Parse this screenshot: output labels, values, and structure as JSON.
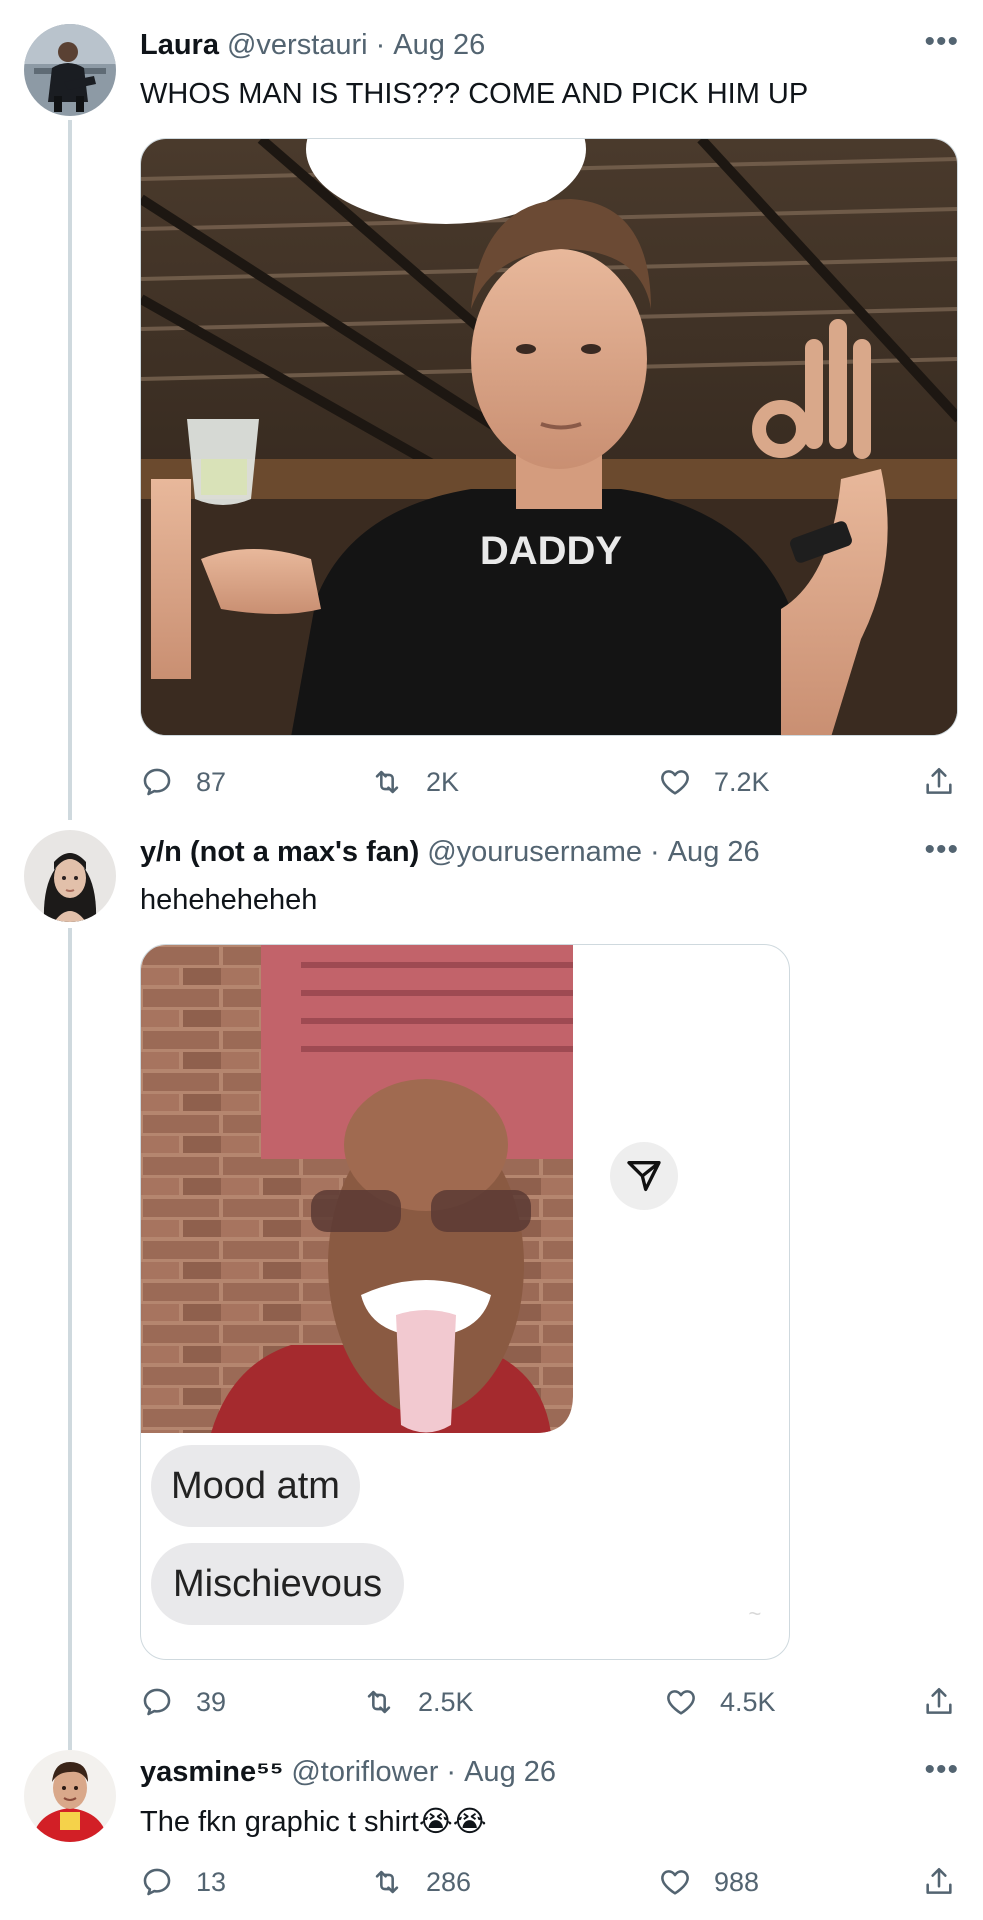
{
  "tweets": [
    {
      "name": "Laura",
      "handle": "@verstauri",
      "sep": "·",
      "date": "Aug 26",
      "more": "•••",
      "text": "WHOS MAN IS THIS??? COME AND PICK HIM UP",
      "media_caption": "DADDY",
      "replies": "87",
      "retweets": "2K",
      "likes": "7.2K"
    },
    {
      "name": "y/n (not a max's fan)",
      "handle": "@yourusername",
      "sep": "·",
      "date": "Aug 26",
      "more": "•••",
      "text": "heheheheheh",
      "bubble1": "Mood atm",
      "bubble2": "Mischievous",
      "replies": "39",
      "retweets": "2.5K",
      "likes": "4.5K"
    },
    {
      "name": "yasmine⁵⁵",
      "handle": "@toriflower",
      "sep": "·",
      "date": "Aug 26",
      "more": "•••",
      "text": "The fkn graphic t shirt😭😭",
      "replies": "13",
      "retweets": "286",
      "likes": "988"
    }
  ],
  "icons": {
    "reply": "reply-icon",
    "retweet": "retweet-icon",
    "like": "heart-icon",
    "share": "share-icon",
    "send": "send-icon"
  },
  "colors": {
    "text_primary": "#0f1419",
    "text_secondary": "#536471",
    "thread_line": "#cfd9de",
    "bubble": "#e9e9eb"
  }
}
